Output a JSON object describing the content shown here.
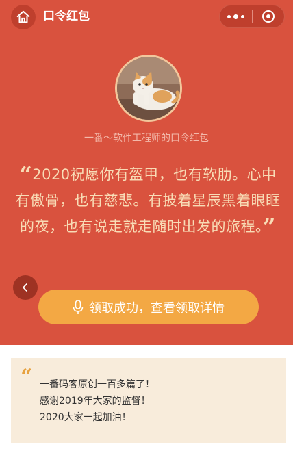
{
  "nav": {
    "title": "口令红包",
    "home_icon": "home-icon",
    "more_icon": "more-dots-icon",
    "close_icon": "target-close-icon"
  },
  "card": {
    "sender_line": "一番～软件工程师的口令红包",
    "open_quote": "“",
    "close_quote": "”",
    "message": "2020祝愿你有盔甲，也有软肋。心中有傲骨，也有慈悲。有披着星辰黑着眼眶的夜，也有说走就走随时出发的旅程。",
    "claim_button": "领取成功，查看领取详情",
    "claim_icon": "microphone-icon",
    "back_icon": "chevron-left-icon"
  },
  "note": {
    "quote_mark": "“",
    "lines": [
      "一番码客原创一百多篇了！",
      "感谢2019年大家的监督！",
      "2020大家一起加油！"
    ]
  },
  "colors": {
    "hero_bg": "#d9523e",
    "button_bg": "#f3a844",
    "message_text": "#f8dcb6",
    "note_bg": "#f8ecdb"
  }
}
